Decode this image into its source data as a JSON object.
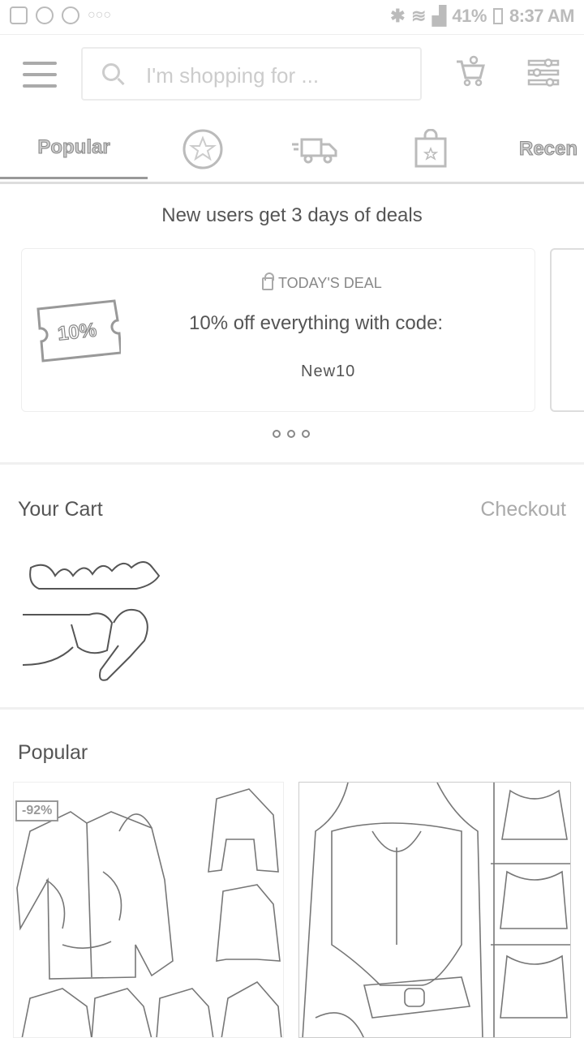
{
  "status_bar": {
    "battery": "41%",
    "time": "8:37 AM"
  },
  "search": {
    "placeholder": "I'm shopping for ..."
  },
  "tabs": [
    {
      "label": "Popular",
      "icon": ""
    },
    {
      "label": "",
      "icon": "star-badge-icon"
    },
    {
      "label": "",
      "icon": "fast-delivery-icon"
    },
    {
      "label": "",
      "icon": "shopping-bag-star-icon"
    },
    {
      "label": "Recen",
      "icon": ""
    }
  ],
  "promo": {
    "title": "New users get 3 days of deals",
    "coupon_text": "10%",
    "deal_head": "TODAY'S DEAL",
    "deal_text": "10% off everything with code:",
    "deal_code": "New10"
  },
  "cart": {
    "title": "Your Cart",
    "action": "Checkout"
  },
  "popular": {
    "title": "Popular",
    "products": [
      {
        "badge": "-92%"
      },
      {
        "badge": ""
      }
    ]
  }
}
